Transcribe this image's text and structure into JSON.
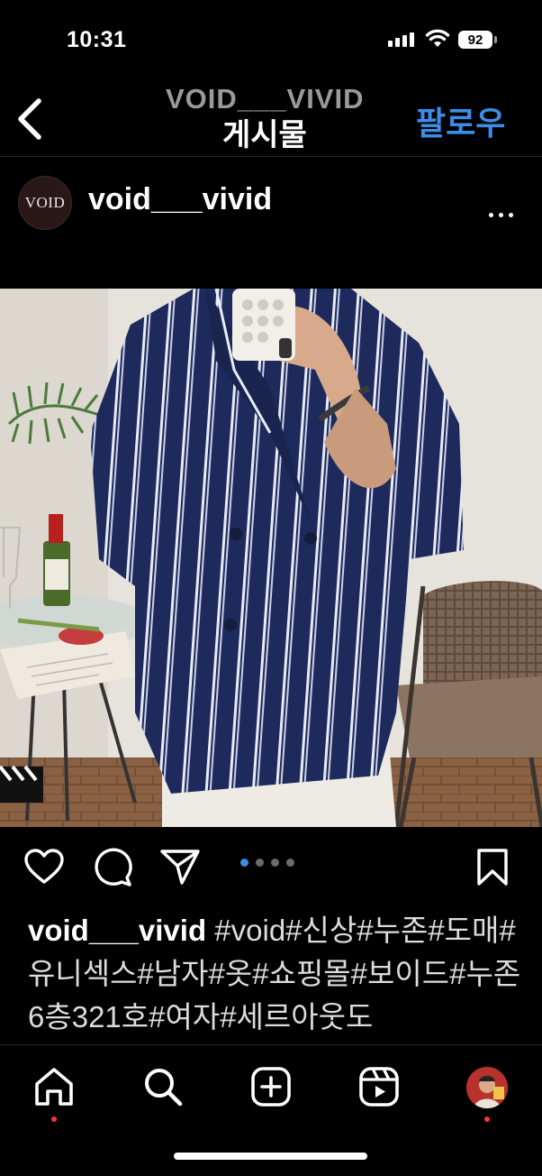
{
  "status_bar": {
    "time": "10:31",
    "battery": "92"
  },
  "header": {
    "ghost_title": "VOID___VIVID",
    "title": "게시물",
    "follow_label": "팔로우",
    "icons": {
      "back": "chevron-left-icon"
    }
  },
  "post": {
    "avatar_text": "VOID",
    "username": "void___vivid",
    "more_icon": "ellipsis-icon",
    "carousel": {
      "count": 4,
      "active": 1
    },
    "actions": [
      "heart-icon",
      "comment-icon",
      "share-icon",
      "bookmark-icon"
    ],
    "caption": {
      "username": "void___vivid",
      "text": " #void#신상#누존#도매#유니섹스#남자#옷#쇼핑몰#보이드#누존6층321호#여자#세르아웃도"
    }
  },
  "bottom_nav": {
    "items": [
      "home-icon",
      "search-icon",
      "create-icon",
      "reels-icon",
      "profile-avatar"
    ]
  },
  "colors": {
    "accent": "#3d8de8",
    "background": "#000000",
    "notification": "#ff3040"
  }
}
